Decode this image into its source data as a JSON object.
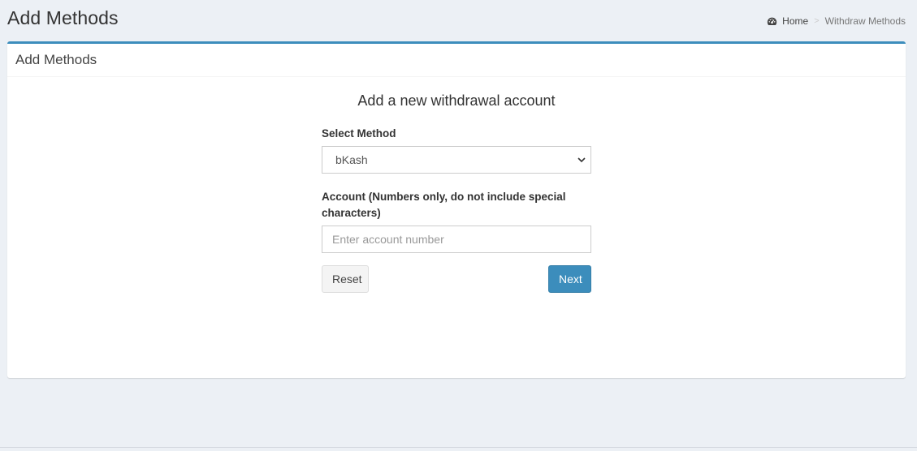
{
  "header": {
    "title": "Add Methods",
    "breadcrumb": {
      "home_label": "Home",
      "separator": ">",
      "current_label": "Withdraw Methods"
    }
  },
  "box": {
    "title": "Add Methods"
  },
  "form": {
    "heading": "Add a new withdrawal account",
    "method_label": "Select Method",
    "method_value": "bKash",
    "account_label": "Account (Numbers only, do not include special characters)",
    "account_placeholder": "Enter account number",
    "account_value": "",
    "reset_label": "Reset",
    "next_label": "Next"
  },
  "colors": {
    "accent": "#3c8dbc",
    "background": "#ecf0f5"
  },
  "icons": {
    "home": "dashboard-icon",
    "select": "chevron-down-icon"
  }
}
